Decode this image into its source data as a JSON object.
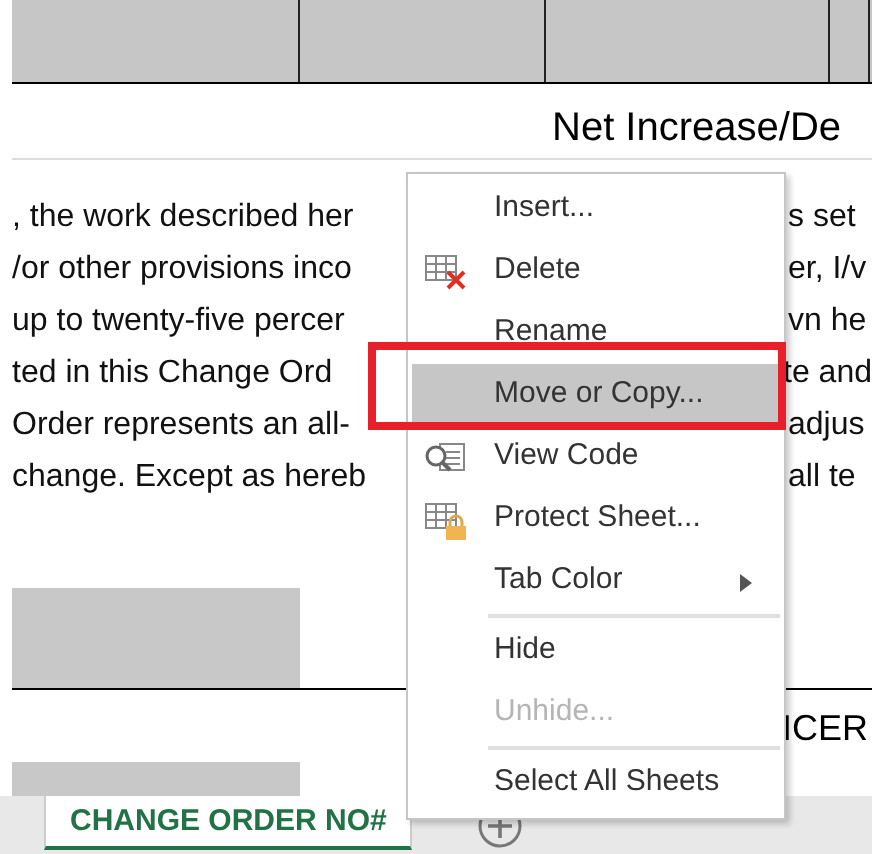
{
  "header": {
    "title": "Net Increase/De"
  },
  "body_lines": [
    {
      "left": ", the work described her",
      "right": "s set"
    },
    {
      "left": "/or other provisions inco",
      "right": "er, I/v"
    },
    {
      "left": "up to twenty-five percer",
      "right": "vn he"
    },
    {
      "left": "ted in this Change Ord",
      "right": "te and"
    },
    {
      "left": "Order represents an all-",
      "right": "adjus"
    },
    {
      "left": "change. Except as hereb",
      "right": "all te"
    }
  ],
  "lower_cell": "ICER",
  "context_menu": [
    {
      "label": "Insert...",
      "kind": "plain",
      "selected": false,
      "disabled": false
    },
    {
      "label": "Delete",
      "kind": "delete",
      "selected": false,
      "disabled": false
    },
    {
      "label": "Rename",
      "kind": "plain",
      "selected": false,
      "disabled": false
    },
    {
      "label": "Move or Copy...",
      "kind": "plain",
      "selected": true,
      "disabled": false
    },
    {
      "label": "View Code",
      "kind": "code",
      "selected": false,
      "disabled": false
    },
    {
      "label": "Protect Sheet...",
      "kind": "protect",
      "selected": false,
      "disabled": false
    },
    {
      "label": "Tab Color",
      "kind": "submenu",
      "selected": false,
      "disabled": false
    },
    {
      "label": "Hide",
      "kind": "plain",
      "selected": false,
      "disabled": false,
      "separator_before": true
    },
    {
      "label": "Unhide...",
      "kind": "plain",
      "selected": false,
      "disabled": true
    },
    {
      "label": "Select All Sheets",
      "kind": "plain",
      "selected": false,
      "disabled": false,
      "separator_before": true
    }
  ],
  "sheet_tabs": [
    {
      "label": "CHANGE ORDER NO#",
      "selected": true
    }
  ]
}
